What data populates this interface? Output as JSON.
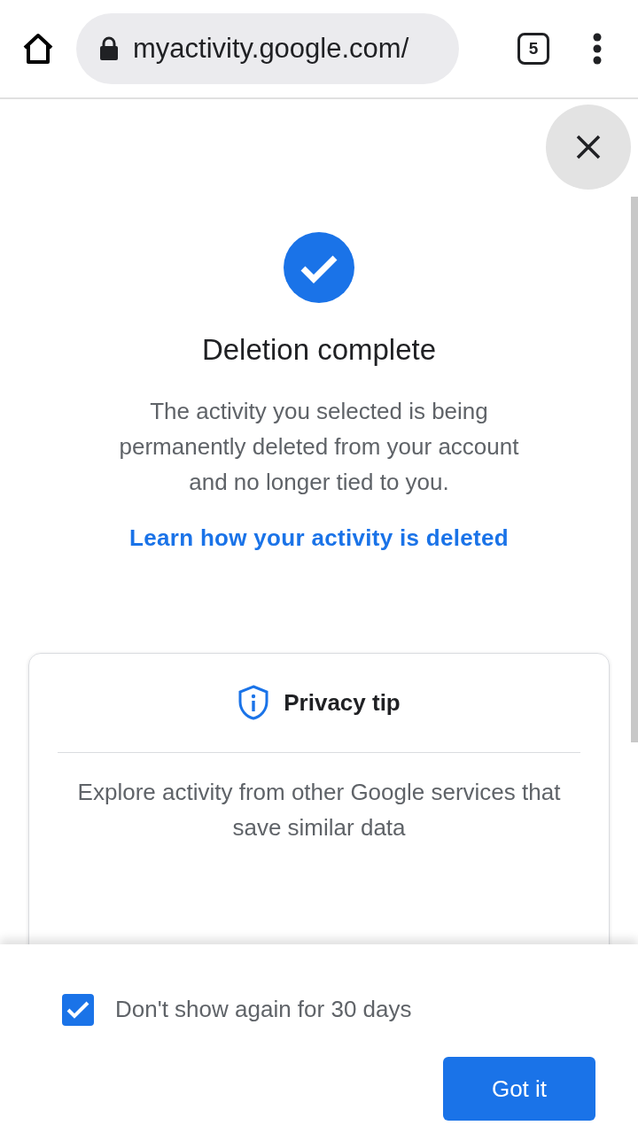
{
  "browser": {
    "url": "myactivity.google.com/",
    "tab_count": "5"
  },
  "dialog": {
    "title": "Deletion complete",
    "message": "The activity you selected is being permanently deleted from your account and no longer tied to you.",
    "link": "Learn how your activity is deleted"
  },
  "privacy_tip": {
    "title": "Privacy tip",
    "text": "Explore activity from other Google services that save similar data"
  },
  "footer": {
    "checkbox": {
      "label": "Don't show again for 30 days",
      "checked": true
    },
    "button": "Got it"
  }
}
